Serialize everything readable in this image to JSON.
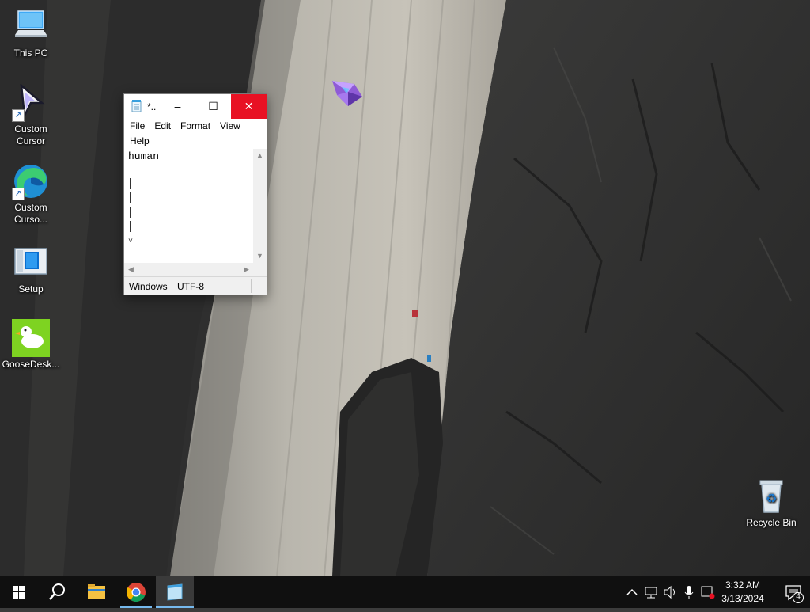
{
  "desktop": {
    "icons": [
      {
        "label": "This PC",
        "icon": "this-pc-icon"
      },
      {
        "label": "Custom\nCursor",
        "icon": "custom-cursor-icon"
      },
      {
        "label": "Custom\nCurso...",
        "icon": "edge-icon"
      },
      {
        "label": "Setup",
        "icon": "setup-icon"
      },
      {
        "label": "GooseDesk...",
        "icon": "goose-icon"
      },
      {
        "label": "Recycle Bin",
        "icon": "recycle-bin-icon"
      }
    ]
  },
  "notepad": {
    "title": "*..",
    "menu": [
      "File",
      "Edit",
      "Format",
      "View",
      "Help"
    ],
    "content": "human",
    "status": {
      "line_ending": "Windows",
      "encoding": "UTF-8"
    },
    "caption": {
      "minimize": "–",
      "maximize": "☐",
      "close": "✕"
    }
  },
  "taskbar": {
    "apps": [
      "start-icon",
      "search-icon",
      "file-explorer-icon",
      "chrome-icon",
      "notepad-icon"
    ],
    "tray": {
      "time": "3:32 AM",
      "date": "3/13/2024",
      "notification_count": "4"
    }
  },
  "colors": {
    "close_button": "#e81123",
    "taskbar": "#101010",
    "active_indicator": "#76b9ed"
  }
}
